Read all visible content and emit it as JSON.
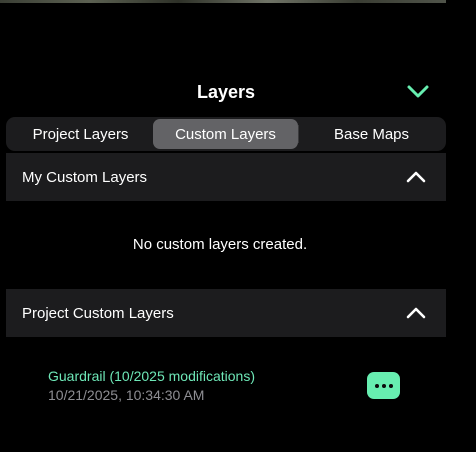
{
  "header": {
    "title": "Layers",
    "collapse_icon": "chevron-down-icon"
  },
  "tabs": [
    {
      "label": "Project Layers",
      "active": false
    },
    {
      "label": "Custom Layers",
      "active": true
    },
    {
      "label": "Base Maps",
      "active": false
    }
  ],
  "my_custom_layers": {
    "title": "My Custom Layers",
    "expanded": true,
    "empty_message": "No custom layers created."
  },
  "project_custom_layers": {
    "title": "Project Custom Layers",
    "expanded": true,
    "items": [
      {
        "name": "Guardrail (10/2025 modifications)",
        "date": "10/21/2025, 10:34:30 AM",
        "action_icon": "more-icon"
      }
    ]
  },
  "colors": {
    "accent": "#67eeb0",
    "layer_name": "#6ee7b7",
    "background": "#000000",
    "panel": "#1c1c1e",
    "active_tab": "#636366",
    "secondary_text": "#8e8e93"
  }
}
